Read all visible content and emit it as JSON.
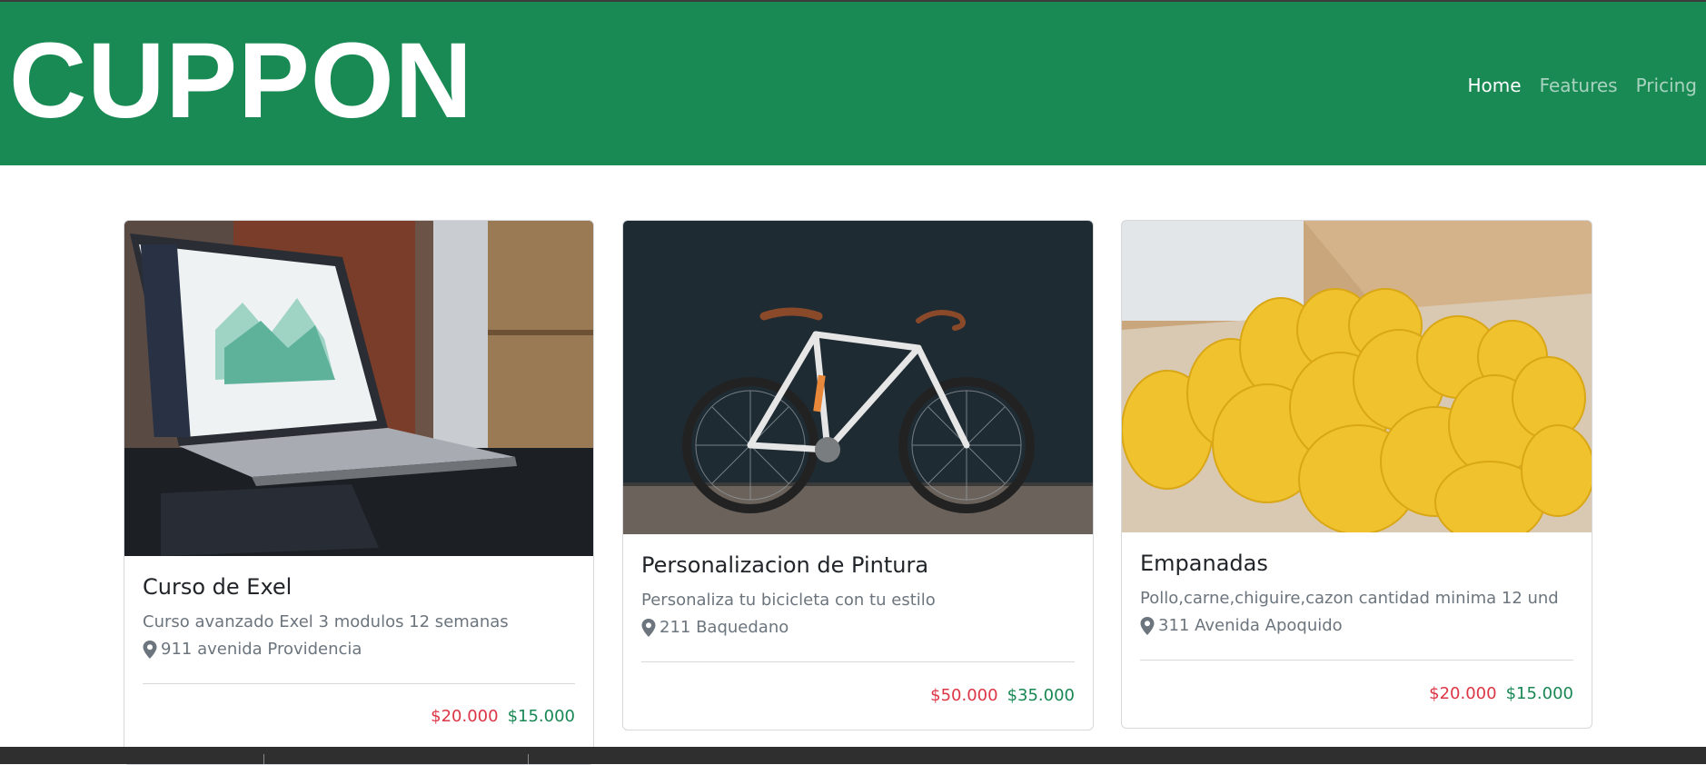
{
  "brand": {
    "name": "CUPPON"
  },
  "nav": {
    "items": [
      {
        "label": "Home",
        "active": true
      },
      {
        "label": "Features",
        "active": false
      },
      {
        "label": "Pricing",
        "active": false
      }
    ]
  },
  "colors": {
    "navbar_bg": "#1a8a55",
    "price_old": "#dc3545",
    "price_new": "#198754",
    "text_muted": "#6c757d"
  },
  "cards": [
    {
      "image": "laptop-with-dashboard-photo",
      "title": "Curso de Exel",
      "description": "Curso avanzado Exel 3 modulos 12 semanas",
      "address": "911 avenida Providencia",
      "price_old": "$20.000",
      "price_new": "$15.000"
    },
    {
      "image": "fixed-gear-bicycle-photo",
      "title": "Personalizacion de Pintura",
      "description": "Personaliza tu bicicleta con tu estilo",
      "address": "211 Baquedano",
      "price_old": "$50.000",
      "price_new": "$35.000"
    },
    {
      "image": "empanadas-box-photo",
      "title": "Empanadas",
      "description": "Pollo,carne,chiguire,cazon cantidad minima 12 und",
      "address": "311 Avenida Apoquido",
      "price_old": "$20.000",
      "price_new": "$15.000"
    }
  ],
  "icons": {
    "location": "map-pin-icon"
  }
}
